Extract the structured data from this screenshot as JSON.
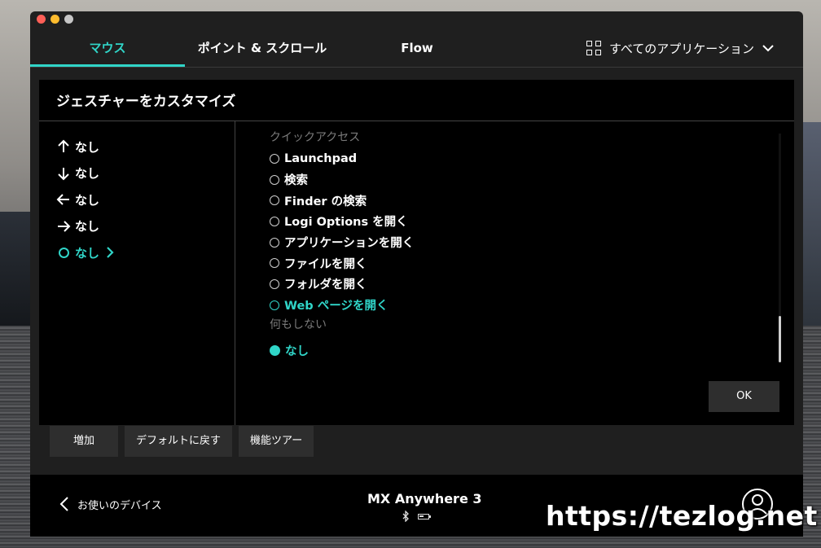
{
  "tabs": [
    {
      "label": "マウス",
      "active": true
    },
    {
      "label": "ポイント & スクロール",
      "active": false
    },
    {
      "label": "Flow",
      "active": false
    }
  ],
  "apps_selector": {
    "label": "すべてのアプリケーション",
    "icon": "grid-icon"
  },
  "panel": {
    "title": "ジェスチャーをカスタマイズ",
    "directions": [
      {
        "icon": "arrow-up-icon",
        "label": "なし",
        "active": false
      },
      {
        "icon": "arrow-down-icon",
        "label": "なし",
        "active": false
      },
      {
        "icon": "arrow-left-icon",
        "label": "なし",
        "active": false
      },
      {
        "icon": "arrow-right-icon",
        "label": "なし",
        "active": false
      },
      {
        "icon": "circle-icon",
        "label": "なし",
        "active": true
      }
    ],
    "sections": [
      {
        "label": "クイックアクセス",
        "options": [
          {
            "label": "Launchpad",
            "selected": false,
            "active": false
          },
          {
            "label": "検索",
            "selected": false,
            "active": false
          },
          {
            "label": "Finder の検索",
            "selected": false,
            "active": false
          },
          {
            "label": "Logi Options を開く",
            "selected": false,
            "active": false
          },
          {
            "label": "アプリケーションを開く",
            "selected": false,
            "active": false
          },
          {
            "label": "ファイルを開く",
            "selected": false,
            "active": false
          },
          {
            "label": "フォルダを開く",
            "selected": false,
            "active": false
          },
          {
            "label": "Web ページを開く",
            "selected": false,
            "active": true
          }
        ]
      },
      {
        "label": "何もしない",
        "options": [
          {
            "label": "なし",
            "selected": true,
            "active": true
          }
        ]
      }
    ],
    "ok_label": "OK"
  },
  "bottom_buttons": [
    "増加",
    "デフォルトに戻す",
    "機能ツアー"
  ],
  "footer": {
    "back_label": "お使いのデバイス",
    "device_name": "MX Anywhere 3",
    "device_status_icons": [
      "bluetooth-icon",
      "battery-icon"
    ],
    "account_icon": "account-icon"
  },
  "watermark": "https://tezlog.net",
  "colors": {
    "accent": "#30d5c8",
    "window_bg": "#1f1f1f",
    "panel_bg": "#000000",
    "button_bg": "#2e2e2e"
  }
}
